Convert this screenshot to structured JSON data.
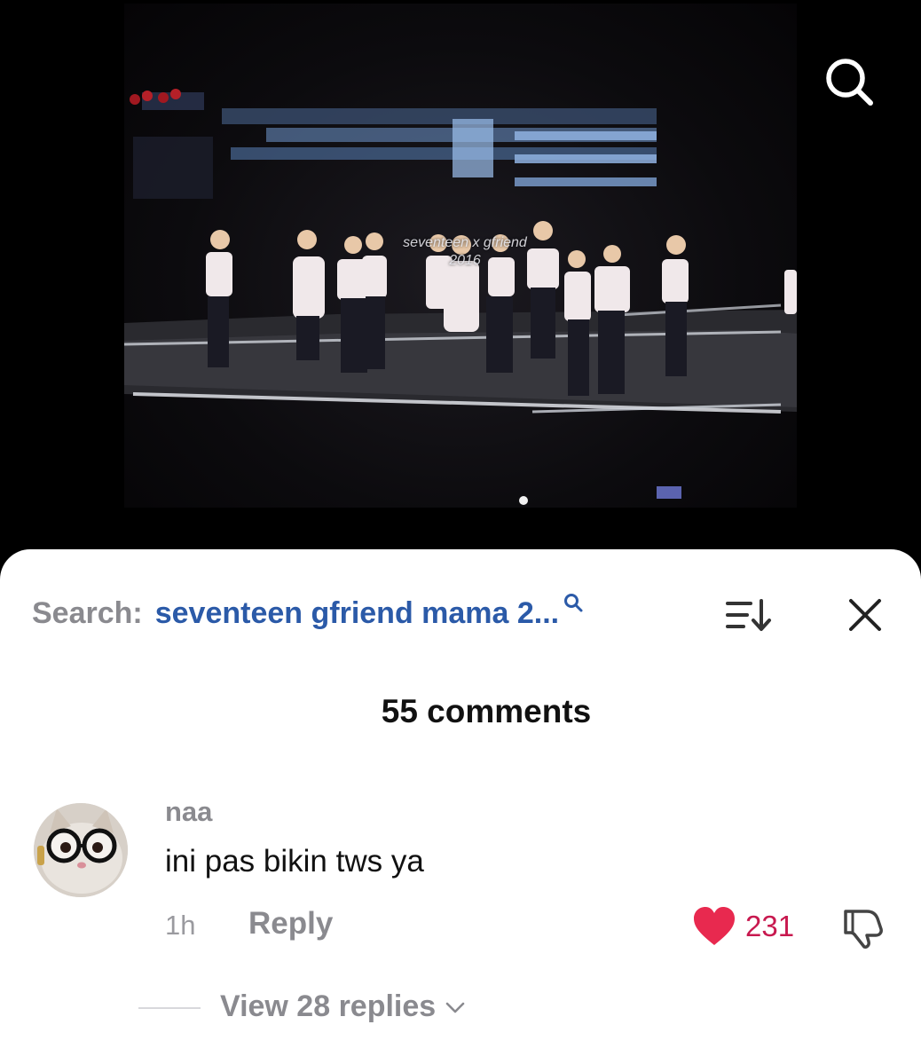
{
  "video": {
    "watermark_line1": "seventeen x gfriend",
    "watermark_line2": "2016"
  },
  "icons": {
    "top_search": "search-icon",
    "query_search": "search-icon",
    "sort": "sort-icon",
    "close": "close-icon",
    "like": "heart-icon",
    "dislike": "thumbs-down-icon",
    "expand": "chevron-down-icon"
  },
  "search": {
    "prefix": "Search:",
    "query": "seventeen gfriend mama 2..."
  },
  "comments_header": {
    "count_label": "55 comments"
  },
  "comment": {
    "username": "naa",
    "text": "ini pas bikin tws ya",
    "time": "1h",
    "reply_label": "Reply",
    "like_count": "231",
    "view_replies_label": "View 28 replies"
  },
  "colors": {
    "query": "#2b5aa8",
    "like": "#e8294f",
    "like_count": "#c8194f",
    "muted": "#8a8a8f"
  }
}
